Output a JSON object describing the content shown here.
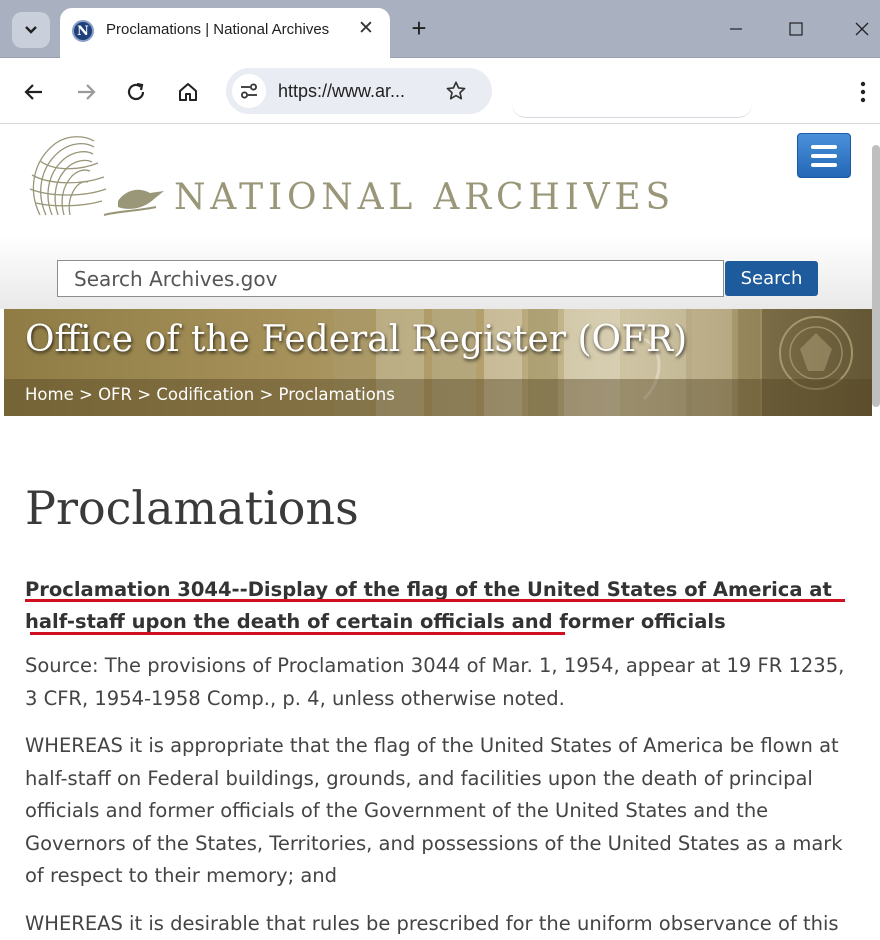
{
  "browser": {
    "tab_title": "Proclamations | National Archives",
    "favicon_letter": "N",
    "url": "https://www.ar..."
  },
  "header": {
    "logo_text": "NATIONAL ARCHIVES",
    "search_placeholder": "Search Archives.gov",
    "search_button": "Search"
  },
  "banner": {
    "title": "Office of the Federal Register (OFR)",
    "breadcrumb": [
      "Home",
      "OFR",
      "Codification",
      "Proclamations"
    ],
    "separator": ">"
  },
  "main": {
    "heading": "Proclamations",
    "doc_link": "Proclamation 3044--Display of the flag of the United States of America at half-staff upon the death of certain officials and former officials",
    "source_text": "Source: The provisions of Proclamation 3044 of Mar. 1, 1954, appear at 19 FR 1235, 3 CFR, 1954-1958 Comp., p. 4, unless otherwise noted.",
    "paragraphs": [
      "WHEREAS it is appropriate that the flag of the United States of America be flown at half-staff on Federal buildings, grounds, and facilities upon the death of principal officials and former officials of the Government of the United States and the Governors of the States, Territories, and possessions of the United States as a mark of respect to their memory; and",
      "WHEREAS it is desirable that rules be prescribed for the uniform observance of this"
    ]
  },
  "colors": {
    "annotation_underline": "#d01020",
    "search_button": "#1d5b9c",
    "menu_button": "#2a72c4"
  }
}
